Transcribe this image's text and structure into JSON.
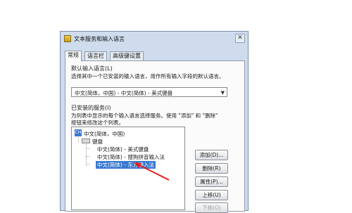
{
  "window": {
    "title": "文本服务和输入语言",
    "close_glyph": "✕",
    "tabs": [
      "常规",
      "语言栏",
      "高级键设置"
    ]
  },
  "default_language": {
    "heading": "默认输入语言(L)",
    "description": "选择其中一个已安装的输入语言，用作所有输入字段的默认语言。",
    "selected": "中文(简体，中国) - 中文(简体) - 美式键盘",
    "arrow_glyph": "▼"
  },
  "installed_services": {
    "heading": "已安装的服务(I)",
    "description_line1": "为列表中显示的每个输入语言选择服务。使用 \"添加\" 和 \"删除\"",
    "description_line2": "按钮来修改这个列表。",
    "lang_badge": "CH",
    "language_node": "中文(简体，中国)",
    "keyboard_node": "键盘",
    "items": [
      "中文(简体) - 美式键盘",
      "中文(简体) - 搜狗拼音输入法",
      "中文(简体) - 东方输入法"
    ]
  },
  "buttons": {
    "add": "添加(D)...",
    "remove": "删除(R)",
    "properties": "属性(P)...",
    "move_up": "上移(U)",
    "move_down": "下移(O)"
  },
  "colors": {
    "selection": "#3a78d0",
    "annotation_arrow": "#e02020"
  }
}
